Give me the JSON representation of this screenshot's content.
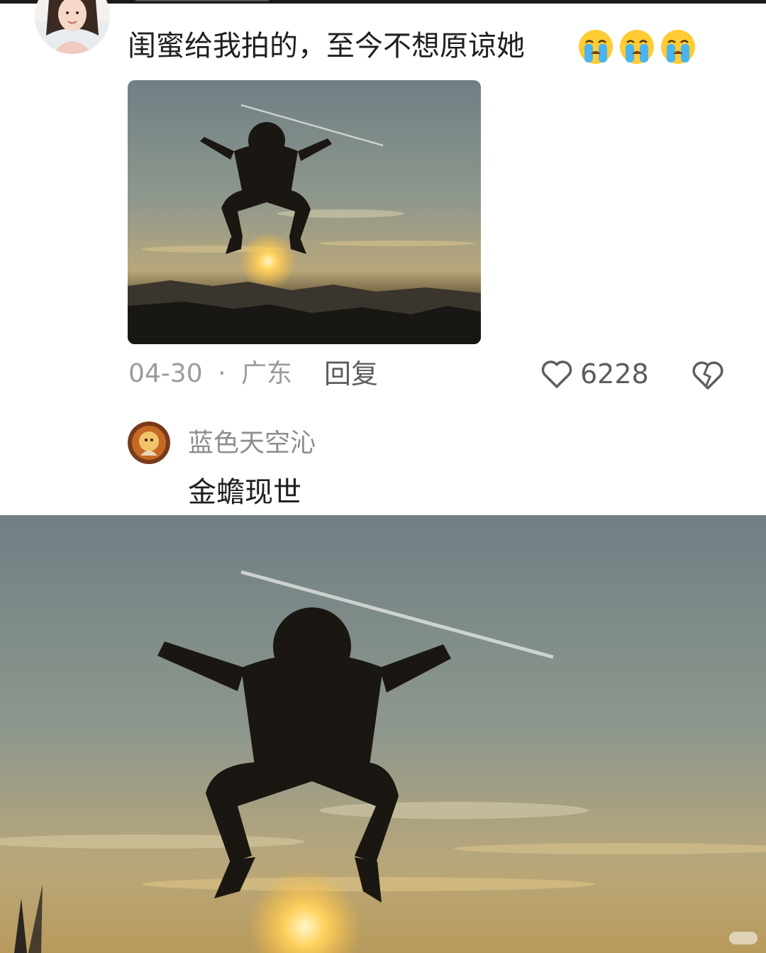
{
  "comment": {
    "text": "闺蜜给我拍的，至今不想原谅她",
    "emojis": [
      "crying-face-icon",
      "crying-face-icon",
      "crying-face-icon"
    ],
    "date": "04-30",
    "separator": "·",
    "location": "广东",
    "reply_label": "回复",
    "like_count": "6228"
  },
  "reply": {
    "username": "蓝色天空沁",
    "text": "金蟾现世"
  },
  "colors": {
    "primary_text": "#1f1f1f",
    "secondary_text": "#9b9b9b",
    "icon": "#5d5d5d"
  }
}
